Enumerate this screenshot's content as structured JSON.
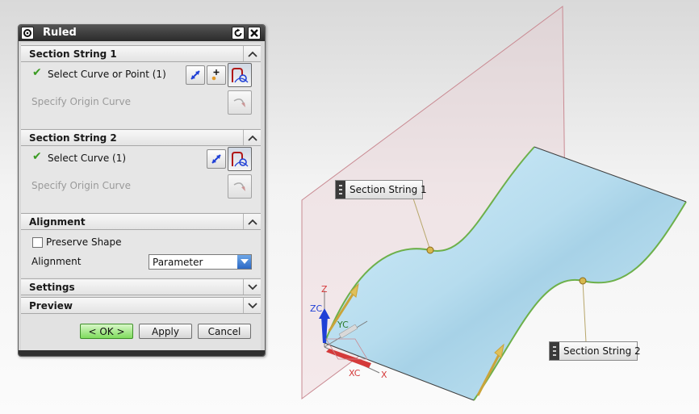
{
  "dialog": {
    "title": "Ruled",
    "sections": {
      "section1": {
        "header": "Section String 1",
        "select_label": "Select Curve or Point (1)",
        "origin_label": "Specify Origin Curve"
      },
      "section2": {
        "header": "Section String 2",
        "select_label": "Select Curve (1)",
        "origin_label": "Specify Origin Curve"
      },
      "alignment": {
        "header": "Alignment",
        "preserve_shape_label": "Preserve Shape",
        "preserve_shape_checked": false,
        "alignment_label": "Alignment",
        "alignment_value": "Parameter"
      },
      "settings": {
        "header": "Settings"
      },
      "preview": {
        "header": "Preview"
      }
    },
    "buttons": {
      "ok": "< OK >",
      "apply": "Apply",
      "cancel": "Cancel"
    }
  },
  "viewport": {
    "callouts": {
      "section1": "Section String 1",
      "section2": "Section String 2"
    },
    "axes": {
      "z": "Z",
      "zc": "ZC",
      "yc": "YC",
      "xc": "XC",
      "x": "X"
    }
  },
  "colors": {
    "surface": "#bfe3f3",
    "surface_edge": "#6db04a",
    "datum_plane": "#c98a92",
    "check": "#3a9b22",
    "ok_button": "#7fdc5c"
  },
  "icons": {
    "gear": "gear-icon",
    "reset": "reset-icon",
    "close": "close-icon",
    "collapse": "chevron-up-icon",
    "expand": "chevron-down-icon",
    "check": "checkmark-icon",
    "dropdown": "dropdown-arrow-icon"
  }
}
